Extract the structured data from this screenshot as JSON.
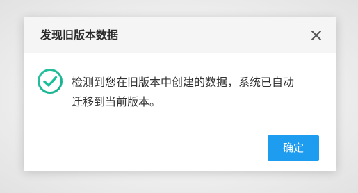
{
  "dialog": {
    "title": "发现旧版本数据",
    "close_icon": "close-icon",
    "status_icon": "success-check-circle-icon",
    "message_line1": "检测到您在旧版本中创建的数据，系统已自动",
    "message_line2": "迁移到当前版本。",
    "confirm_label": "确定"
  },
  "colors": {
    "accent": "#1e9cf0",
    "success": "#19be9b",
    "header_bg": "#f5f5f5"
  }
}
